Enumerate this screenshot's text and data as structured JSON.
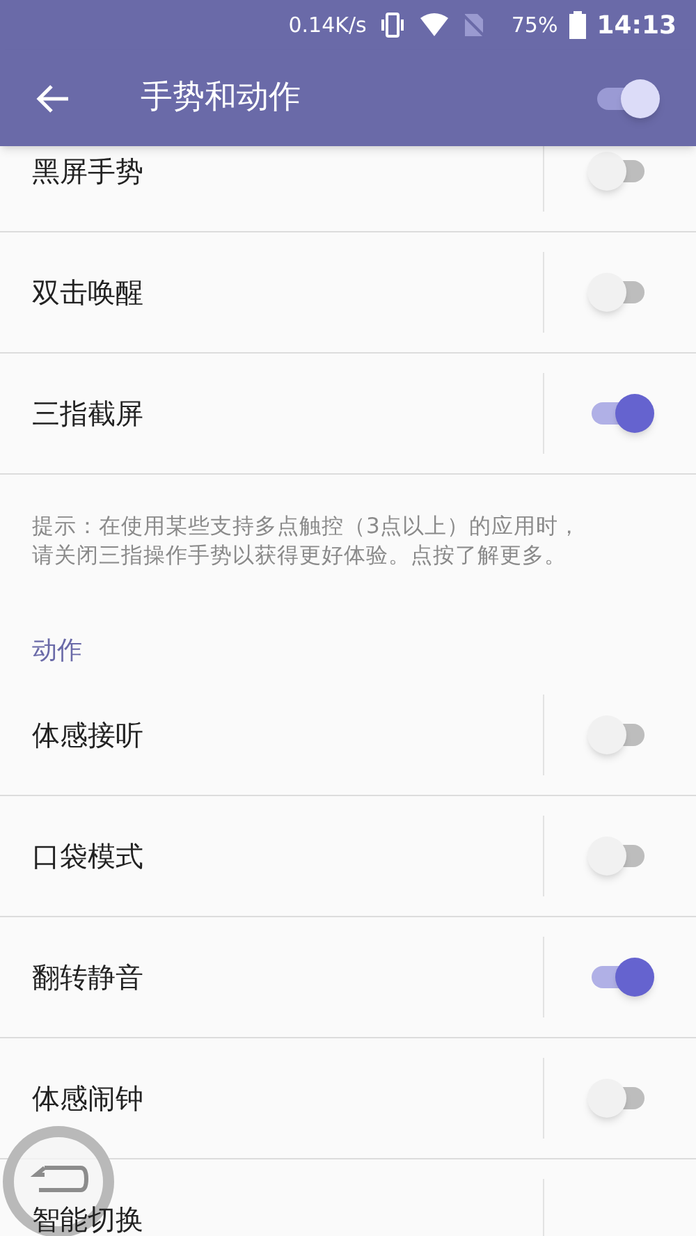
{
  "status_bar": {
    "speed": "0.14K/s",
    "battery": "75%",
    "time": "14:13"
  },
  "toolbar": {
    "title": "手势和动作",
    "master_on": true
  },
  "gestures": [
    {
      "label": "黑屏手势",
      "on": false
    },
    {
      "label": "双击唤醒",
      "on": false
    },
    {
      "label": "三指截屏",
      "on": true
    }
  ],
  "hint": "提示：在使用某些支持多点触控（3点以上）的应用时，请关闭三指操作手势以获得更好体验。点按了解更多。",
  "section": "动作",
  "actions": [
    {
      "label": "体感接听",
      "on": false
    },
    {
      "label": "口袋模式",
      "on": false
    },
    {
      "label": "翻转静音",
      "on": true
    },
    {
      "label": "体感闹钟",
      "on": false
    },
    {
      "label": "智能切换"
    }
  ]
}
